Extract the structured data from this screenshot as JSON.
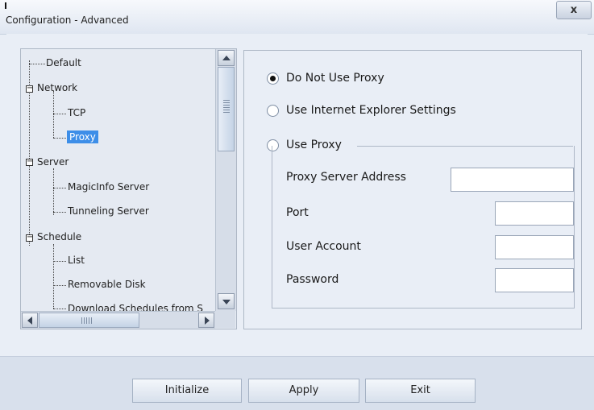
{
  "window": {
    "title": "Configuration - Advanced",
    "close_label": "x"
  },
  "tree": {
    "items": [
      {
        "label": "Default"
      },
      {
        "label": "Network"
      },
      {
        "label": "TCP"
      },
      {
        "label": "Proxy"
      },
      {
        "label": "Server"
      },
      {
        "label": "MagicInfo Server"
      },
      {
        "label": "Tunneling Server"
      },
      {
        "label": "Schedule"
      },
      {
        "label": "List"
      },
      {
        "label": "Removable Disk"
      },
      {
        "label": "Download Schedules from S"
      }
    ],
    "selected": "Proxy"
  },
  "proxy": {
    "options": [
      {
        "label": "Do Not Use Proxy",
        "checked": true
      },
      {
        "label": "Use Internet Explorer Settings",
        "checked": false
      },
      {
        "label": "Use Proxy",
        "checked": false
      }
    ],
    "fields": [
      {
        "label": "Proxy Server Address",
        "value": ""
      },
      {
        "label": "Port",
        "value": ""
      },
      {
        "label": "User Account",
        "value": ""
      },
      {
        "label": "Password",
        "value": ""
      }
    ]
  },
  "buttons": {
    "initialize": "Initialize",
    "apply": "Apply",
    "exit": "Exit"
  }
}
